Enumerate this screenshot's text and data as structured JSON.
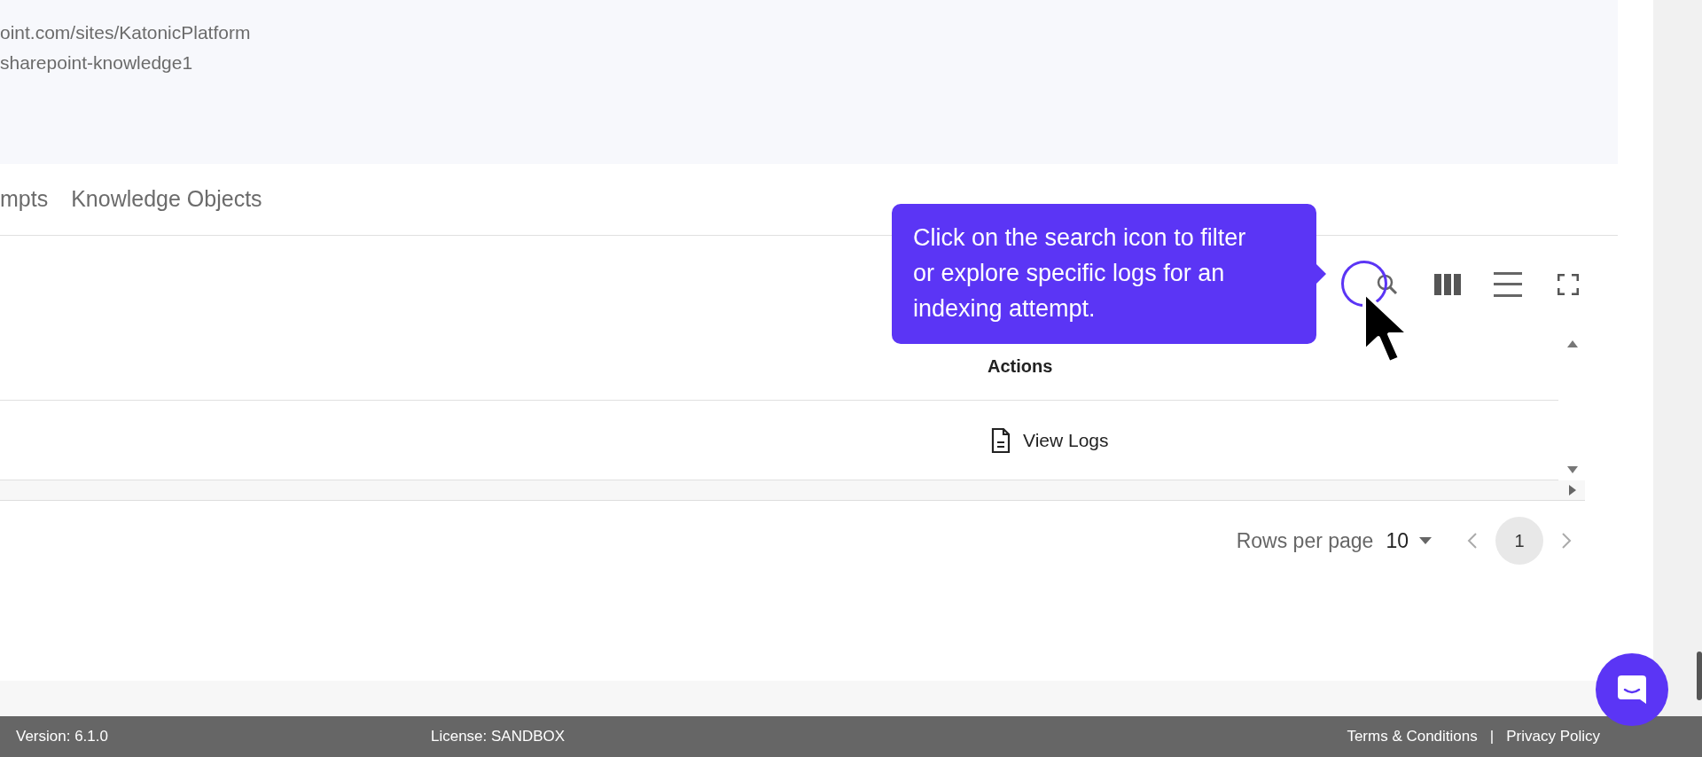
{
  "info_lines": [
    "oint.com/sites/KatonicPlatform",
    "sharepoint-knowledge1"
  ],
  "tabs": [
    {
      "label": "mpts",
      "selected": false
    },
    {
      "label": "Knowledge Objects",
      "selected": false
    }
  ],
  "tooltip": {
    "text": "Click on the search icon to filter or explore specific logs for an indexing attempt."
  },
  "table": {
    "columns": [
      "Actions"
    ],
    "rows": [
      {
        "action": "View Logs"
      }
    ]
  },
  "pagination": {
    "rows_per_page_label": "Rows per page",
    "rows_per_page": "10",
    "pages": [
      {
        "label": "1",
        "selected": true
      }
    ]
  },
  "footer": {
    "version": "Version: 6.1.0",
    "license": "License: SANDBOX",
    "links": [
      "Terms & Conditions",
      "Privacy Policy"
    ],
    "separator": "|"
  }
}
